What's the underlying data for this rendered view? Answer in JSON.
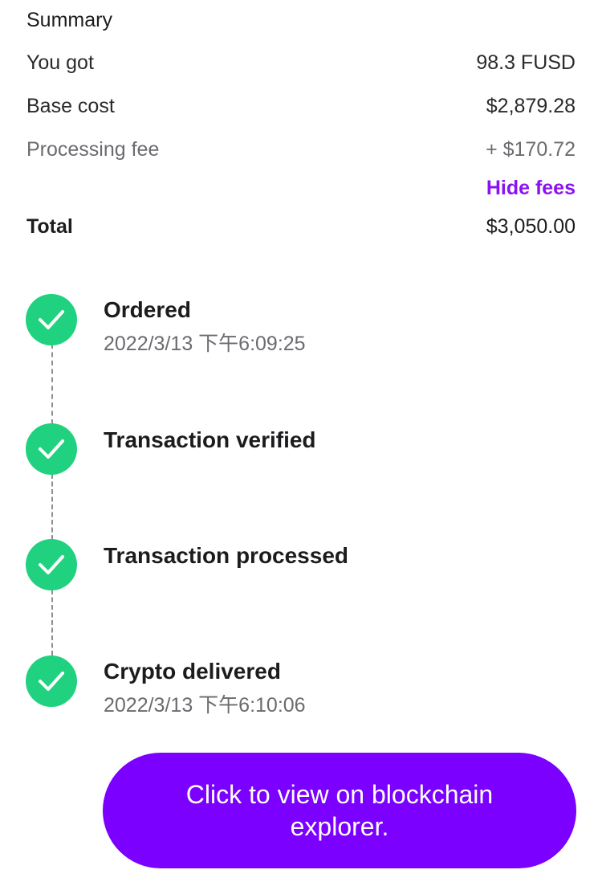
{
  "summary": {
    "title": "Summary",
    "rows": [
      {
        "label": "You got",
        "value": "98.3 FUSD"
      },
      {
        "label": "Base cost",
        "value": "$2,879.28"
      },
      {
        "label": "Processing fee",
        "value": "+ $170.72"
      }
    ],
    "hide_fees_label": "Hide fees",
    "total": {
      "label": "Total",
      "value": "$3,050.00"
    }
  },
  "timeline": {
    "steps": [
      {
        "title": "Ordered",
        "time": "2022/3/13 下午6:09:25"
      },
      {
        "title": "Transaction verified",
        "time": ""
      },
      {
        "title": "Transaction processed",
        "time": ""
      },
      {
        "title": "Crypto delivered",
        "time": "2022/3/13 下午6:10:06"
      }
    ]
  },
  "explorer_button": {
    "label": "Click to view on blockchain explorer."
  },
  "colors": {
    "accent": "#7b00ff",
    "link": "#8a12f2",
    "success": "#20d27f"
  },
  "icons": {
    "step_icon": "checkmark-circle-icon"
  }
}
